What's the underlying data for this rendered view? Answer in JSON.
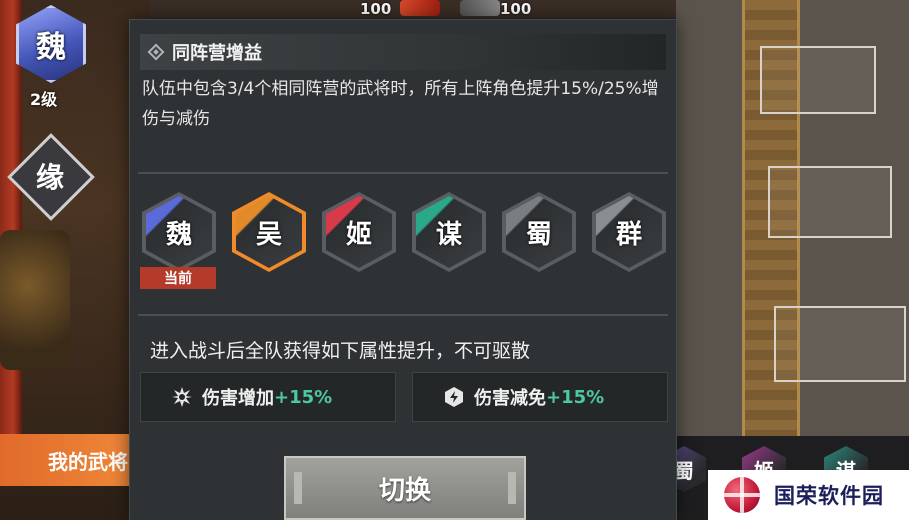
{
  "hud": {
    "hp_left": "100",
    "hp_right": "100",
    "faction_char": "魏",
    "faction_level": "2级",
    "fate_char": "缘",
    "my_generals": "我的武将"
  },
  "panel": {
    "title": "同阵营增益",
    "description": "队伍中包含3/4个相同阵营的武将时，所有上阵角色提升15%/25%增伤与减伤",
    "factions": [
      {
        "char": "魏",
        "color": "#5a6ad8",
        "tag": "当前"
      },
      {
        "char": "吴",
        "color": "#e08a2a"
      },
      {
        "char": "姬",
        "color": "#d83a4a"
      },
      {
        "char": "谋",
        "color": "#2aa88a"
      },
      {
        "char": "蜀",
        "color": "#7a7e82"
      },
      {
        "char": "群",
        "color": "#8a8e92"
      }
    ],
    "bonus_intro": "进入战斗后全队获得如下属性提升，不可驱散",
    "stats": [
      {
        "icon": "damage-boost-icon",
        "label": "伤害增加",
        "value": "+15%"
      },
      {
        "icon": "damage-reduction-icon",
        "label": "伤害减免",
        "value": "+15%"
      }
    ],
    "switch_label": "切换"
  },
  "strip": {
    "factions": [
      {
        "char": "蜀",
        "color": "#5a4e8a"
      },
      {
        "char": "姬",
        "color": "#9a3a8a"
      },
      {
        "char": "谋",
        "color": "#2a8a7a"
      }
    ]
  },
  "watermark": "国荣软件园",
  "colors": {
    "accent_green": "#4ec8a0",
    "selected_orange": "#f08a2a",
    "current_tag_red": "#b43a2a"
  }
}
